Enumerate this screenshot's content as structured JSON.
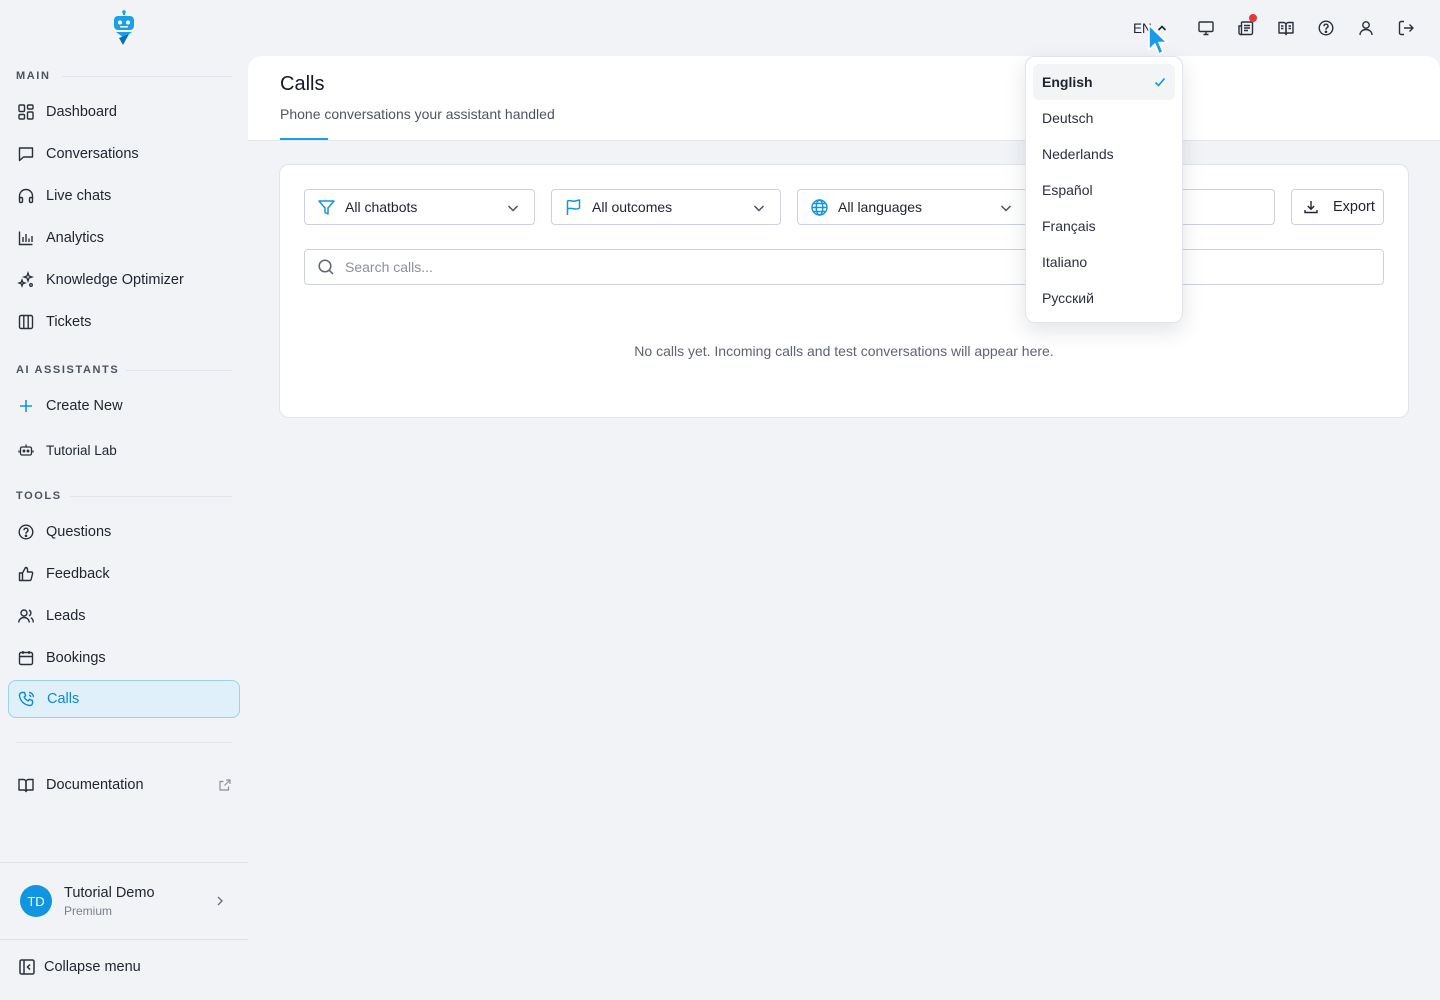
{
  "sidebar": {
    "sections": {
      "main": "MAIN",
      "ai": "AI ASSISTANTS",
      "tools": "TOOLS"
    },
    "main_items": [
      {
        "label": "Dashboard",
        "icon": "dashboard-icon"
      },
      {
        "label": "Conversations",
        "icon": "chat-icon"
      },
      {
        "label": "Live chats",
        "icon": "headset-icon"
      },
      {
        "label": "Analytics",
        "icon": "bar-chart-icon"
      },
      {
        "label": "Knowledge Optimizer",
        "icon": "sparkles-icon"
      },
      {
        "label": "Tickets",
        "icon": "columns-icon"
      }
    ],
    "ai_items": [
      {
        "label": "Create New",
        "icon": "plus-icon"
      },
      {
        "label": "Tutorial Lab",
        "icon": "bot-icon"
      }
    ],
    "tools_items": [
      {
        "label": "Questions",
        "icon": "help-circle-icon"
      },
      {
        "label": "Feedback",
        "icon": "thumbs-up-icon"
      },
      {
        "label": "Leads",
        "icon": "users-icon"
      },
      {
        "label": "Bookings",
        "icon": "calendar-icon"
      },
      {
        "label": "Calls",
        "icon": "phone-call-icon",
        "active": true
      }
    ],
    "documentation": "Documentation",
    "user": {
      "initials": "TD",
      "name": "Tutorial Demo",
      "plan": "Premium"
    },
    "collapse": "Collapse menu"
  },
  "topbar": {
    "language_code": "EN"
  },
  "header": {
    "title": "Calls",
    "subtitle": "Phone conversations your assistant handled"
  },
  "filters": {
    "chatbots": "All chatbots",
    "outcomes": "All outcomes",
    "languages": "All languages",
    "export": "Export",
    "search_placeholder": "Search calls..."
  },
  "empty_message": "No calls yet. Incoming calls and test conversations will appear here.",
  "language_menu": {
    "options": [
      "English",
      "Deutsch",
      "Nederlands",
      "Español",
      "Français",
      "Italiano",
      "Русский"
    ],
    "selected": "English"
  },
  "colors": {
    "accent": "#1195e0",
    "active_bg": "#e0f0fb",
    "notification": "#e5383b"
  }
}
